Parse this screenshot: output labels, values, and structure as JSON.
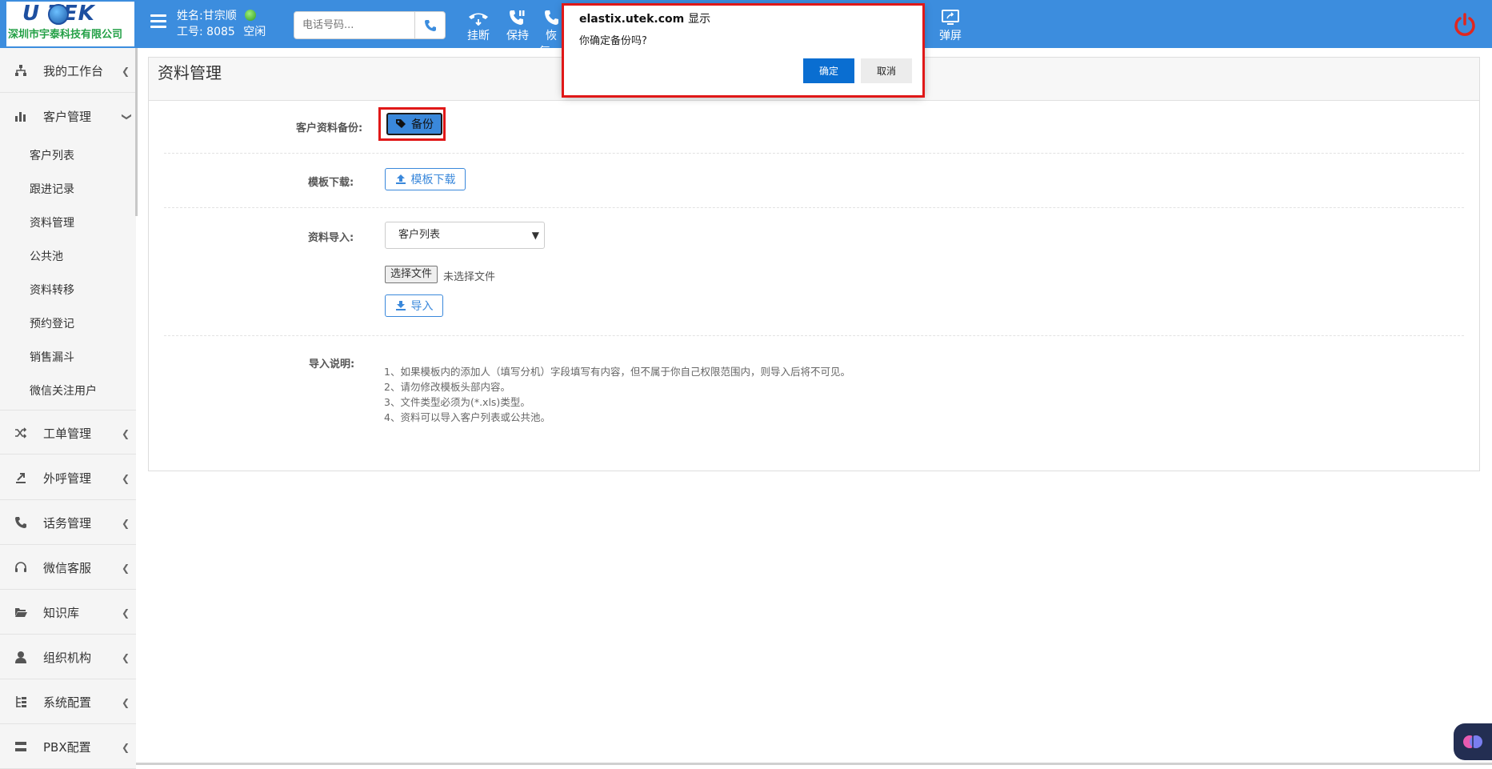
{
  "app": {
    "logo_main": "U TEK",
    "logo_sub": "深圳市宇泰科技有限公司"
  },
  "agent": {
    "name_label": "姓名:",
    "name": "甘宗顺",
    "id_label": "工号:",
    "id": "8085",
    "status": "空闲"
  },
  "phone": {
    "placeholder": "电话号码..."
  },
  "toolbar": {
    "hangup": "挂断",
    "hold": "保持",
    "resume": "恢复",
    "popup": "弹屏"
  },
  "sidebar": {
    "items": [
      {
        "label": "我的工作台",
        "icon": "sitemap-icon"
      },
      {
        "label": "客户管理",
        "icon": "bar-chart-icon"
      },
      {
        "label": "工单管理",
        "icon": "shuffle-icon"
      },
      {
        "label": "外呼管理",
        "icon": "outbound-icon"
      },
      {
        "label": "话务管理",
        "icon": "phone-icon"
      },
      {
        "label": "微信客服",
        "icon": "headset-icon"
      },
      {
        "label": "知识库",
        "icon": "folder-open-icon"
      },
      {
        "label": "组织机构",
        "icon": "user-icon"
      },
      {
        "label": "系统配置",
        "icon": "tree-icon"
      },
      {
        "label": "PBX配置",
        "icon": "server-icon"
      }
    ],
    "subitems": [
      "客户列表",
      "跟进记录",
      "资料管理",
      "公共池",
      "资料转移",
      "预约登记",
      "销售漏斗",
      "微信关注用户"
    ]
  },
  "page": {
    "title": "资料管理",
    "backup_label": "客户资料备份:",
    "backup_button": "备份",
    "template_label": "模板下载:",
    "template_button": "模板下载",
    "import_label": "资料导入:",
    "import_select_value": "客户列表",
    "file_button": "选择文件",
    "file_none": "未选择文件",
    "import_button": "导入",
    "notes_label": "导入说明:",
    "notes": [
      "1、如果模板内的添加人（填写分机）字段填写有内容，但不属于你自己权限范围内，则导入后将不可见。",
      "2、请勿修改模板头部内容。",
      "3、文件类型必须为(*.xls)类型。",
      "4、资料可以导入客户列表或公共池。"
    ]
  },
  "dialog": {
    "origin": "elastix.utek.com",
    "suffix": "显示",
    "message": "你确定备份吗?",
    "ok": "确定",
    "cancel": "取消"
  },
  "colors": {
    "topbar": "#3c8dde",
    "primary": "#0a6ed1",
    "highlight": "#e01818"
  }
}
